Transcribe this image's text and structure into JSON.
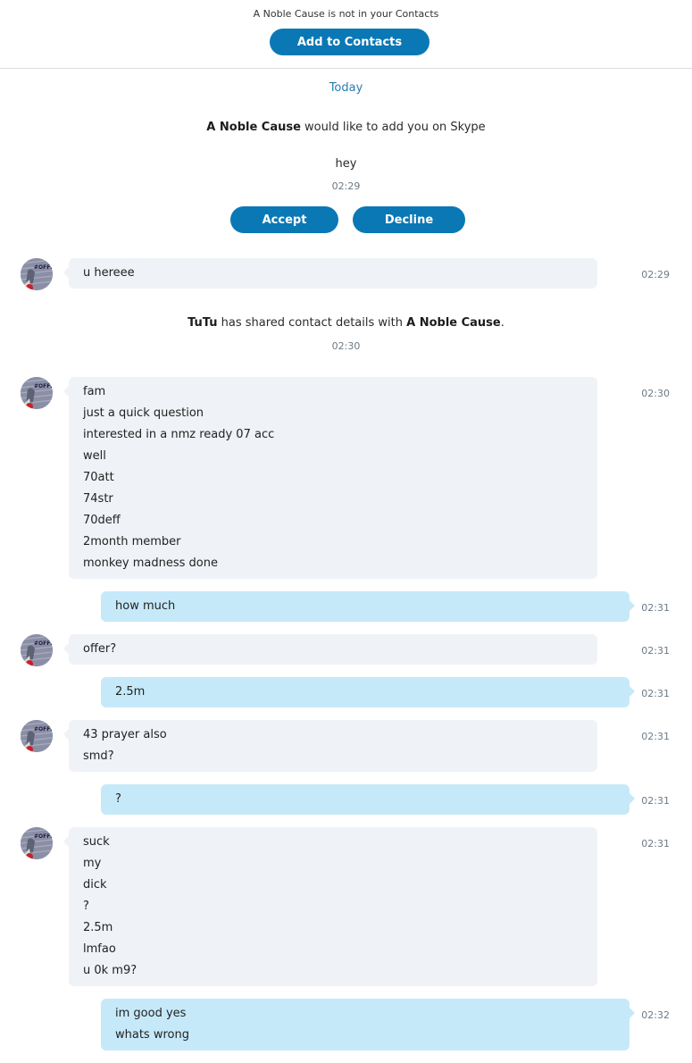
{
  "header": {
    "notice": "A Noble Cause is not in your Contacts",
    "add_button": "Add to Contacts"
  },
  "date_separator": "Today",
  "request": {
    "name": "A Noble Cause",
    "text": " would like to add you on Skype",
    "message": "hey",
    "time": "02:29",
    "accept": "Accept",
    "decline": "Decline"
  },
  "share_event": {
    "actor": "TuTu",
    "mid": " has shared contact details with ",
    "target": "A Noble Cause",
    "end": ".",
    "time": "02:30"
  },
  "avatar_icon": "contact-avatar-icon",
  "colors": {
    "accent": "#0a78b5",
    "incoming_bubble": "#eff2f7",
    "outgoing_bubble": "#c6e9f9"
  },
  "messages": [
    {
      "dir": "in",
      "time": "02:29",
      "lines": [
        "u hereee"
      ]
    },
    {
      "dir": "in",
      "time": "02:30",
      "lines": [
        "fam",
        "just a quick question",
        "interested in a nmz ready 07 acc",
        "well",
        "70att",
        "74str",
        "70deff",
        "2month member",
        "monkey madness done"
      ]
    },
    {
      "dir": "out",
      "time": "02:31",
      "lines": [
        "how much"
      ]
    },
    {
      "dir": "in",
      "time": "02:31",
      "lines": [
        "offer?"
      ]
    },
    {
      "dir": "out",
      "time": "02:31",
      "lines": [
        "2.5m"
      ]
    },
    {
      "dir": "in",
      "time": "02:31",
      "lines": [
        "43 prayer also",
        "smd?"
      ]
    },
    {
      "dir": "out",
      "time": "02:31",
      "lines": [
        "?"
      ]
    },
    {
      "dir": "in",
      "time": "02:31",
      "lines": [
        "suck",
        "my",
        "dick",
        "?",
        "2.5m",
        "lmfao",
        "u 0k m9?"
      ]
    },
    {
      "dir": "out",
      "time": "02:32",
      "lines": [
        "im good yes",
        "whats wrong"
      ]
    }
  ]
}
